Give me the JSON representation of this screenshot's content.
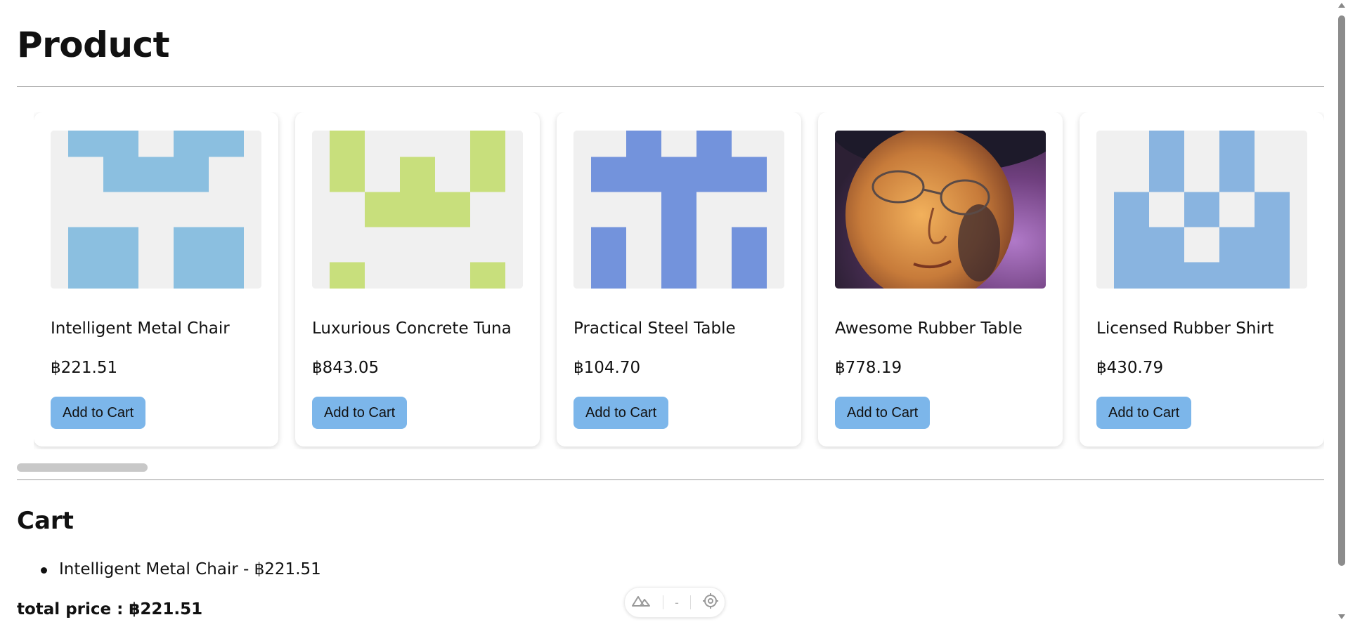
{
  "page": {
    "title": "Product"
  },
  "products": [
    {
      "name": "Intelligent Metal Chair",
      "price": "฿221.51",
      "button_label": "Add to Cart",
      "image": "identicon-blue",
      "accent": "#8bbfe0"
    },
    {
      "name": "Luxurious Concrete Tuna",
      "price": "฿843.05",
      "button_label": "Add to Cart",
      "image": "identicon-green",
      "accent": "#c8df7c"
    },
    {
      "name": "Practical Steel Table",
      "price": "฿104.70",
      "button_label": "Add to Cart",
      "image": "identicon-periwinkle",
      "accent": "#7393dc"
    },
    {
      "name": "Awesome Rubber Table",
      "price": "฿778.19",
      "button_label": "Add to Cart",
      "image": "man-with-glasses-photo",
      "accent": "#8a4f86"
    },
    {
      "name": "Licensed Rubber Shirt",
      "price": "฿430.79",
      "button_label": "Add to Cart",
      "image": "identicon-lightblue",
      "accent": "#89b4e0"
    }
  ],
  "cart": {
    "title": "Cart",
    "items": [
      {
        "label": "Intelligent Metal Chair - ฿221.51"
      }
    ],
    "total_label": "total price : ฿221.51"
  },
  "devtools": {
    "logo_icon": "nuxt-logo-icon",
    "separator_text": "-",
    "inspect_icon": "crosshair-icon"
  },
  "colors": {
    "button": "#7cb6ea",
    "image_placeholder": "#f0f0f0"
  }
}
